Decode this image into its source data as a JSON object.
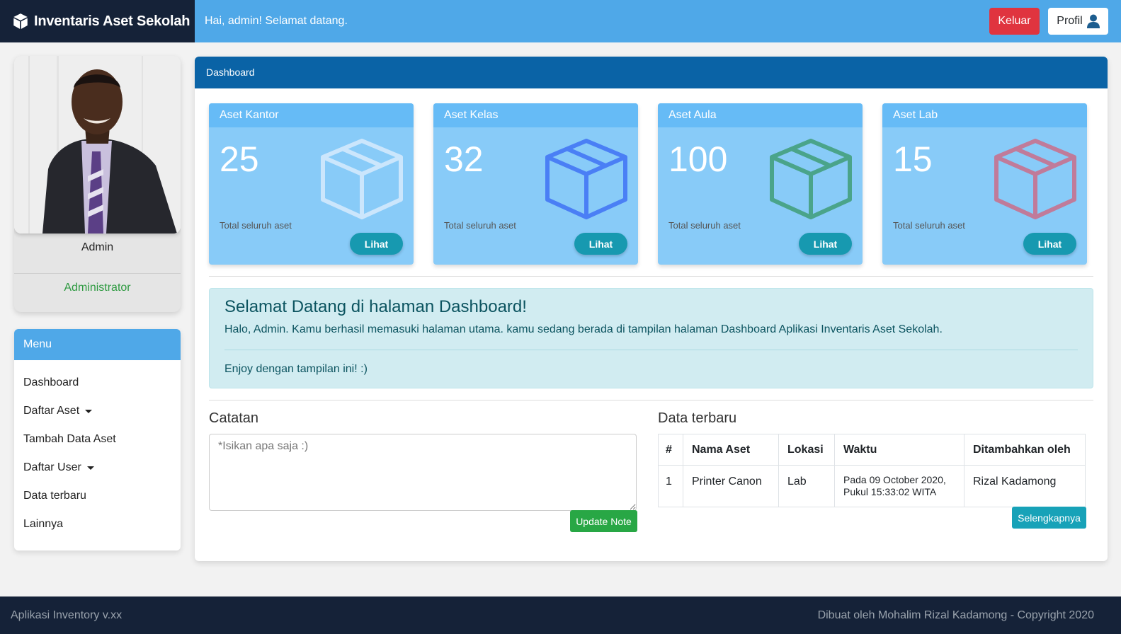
{
  "brand": {
    "title": "Inventaris Aset Sekolah",
    "icon": "box-icon"
  },
  "topbar": {
    "greeting": "Hai, admin! Selamat datang.",
    "logout_label": "Keluar",
    "profile_label": "Profil",
    "colors": {
      "bar": "#4fa8e8",
      "logout": "#e0343f"
    }
  },
  "profile": {
    "name": "Admin",
    "role": "Administrator"
  },
  "menu": {
    "title": "Menu",
    "items": [
      {
        "label": "Dashboard"
      },
      {
        "label": "Daftar Aset"
      },
      {
        "label": "Tambah Data Aset"
      },
      {
        "label": "Daftar User"
      },
      {
        "label": "Data terbaru"
      },
      {
        "label": "Lainnya"
      }
    ]
  },
  "main": {
    "header": "Dashboard",
    "stats": [
      {
        "title": "Aset Kantor",
        "count": "25",
        "label": "Total seluruh aset",
        "button": "Lihat",
        "icon_color": "#cbe6fc"
      },
      {
        "title": "Aset Kelas",
        "count": "32",
        "label": "Total seluruh aset",
        "button": "Lihat",
        "icon_color": "#4a7ff5"
      },
      {
        "title": "Aset Aula",
        "count": "100",
        "label": "Total seluruh aset",
        "button": "Lihat",
        "icon_color": "#4aa48a"
      },
      {
        "title": "Aset Lab",
        "count": "15",
        "label": "Total seluruh aset",
        "button": "Lihat",
        "icon_color": "#c07b9a"
      }
    ],
    "welcome": {
      "title": "Selamat Datang di halaman Dashboard!",
      "text": "Halo, Admin. Kamu berhasil memasuki halaman utama. kamu sedang berada di tampilan halaman Dashboard Aplikasi Inventaris Aset Sekolah.",
      "footer": "Enjoy dengan tampilan ini! :)"
    },
    "notes": {
      "title": "Catatan",
      "placeholder": "*Isikan apa saja :)",
      "button": "Update Note"
    },
    "recent": {
      "title": "Data terbaru",
      "columns": [
        "#",
        "Nama Aset",
        "Lokasi",
        "Waktu",
        "Ditambahkan oleh"
      ],
      "rows": [
        {
          "no": "1",
          "name": "Printer Canon",
          "location": "Lab",
          "time_line1": "Pada 09 October 2020,",
          "time_line2": "Pukul 15:33:02 WITA",
          "added_by": "Rizal Kadamong"
        }
      ],
      "button": "Selengkapnya"
    }
  },
  "footer": {
    "left": "Aplikasi Inventory v.xx",
    "right": "Dibuat oleh Mohalim Rizal Kadamong - Copyright 2020"
  }
}
